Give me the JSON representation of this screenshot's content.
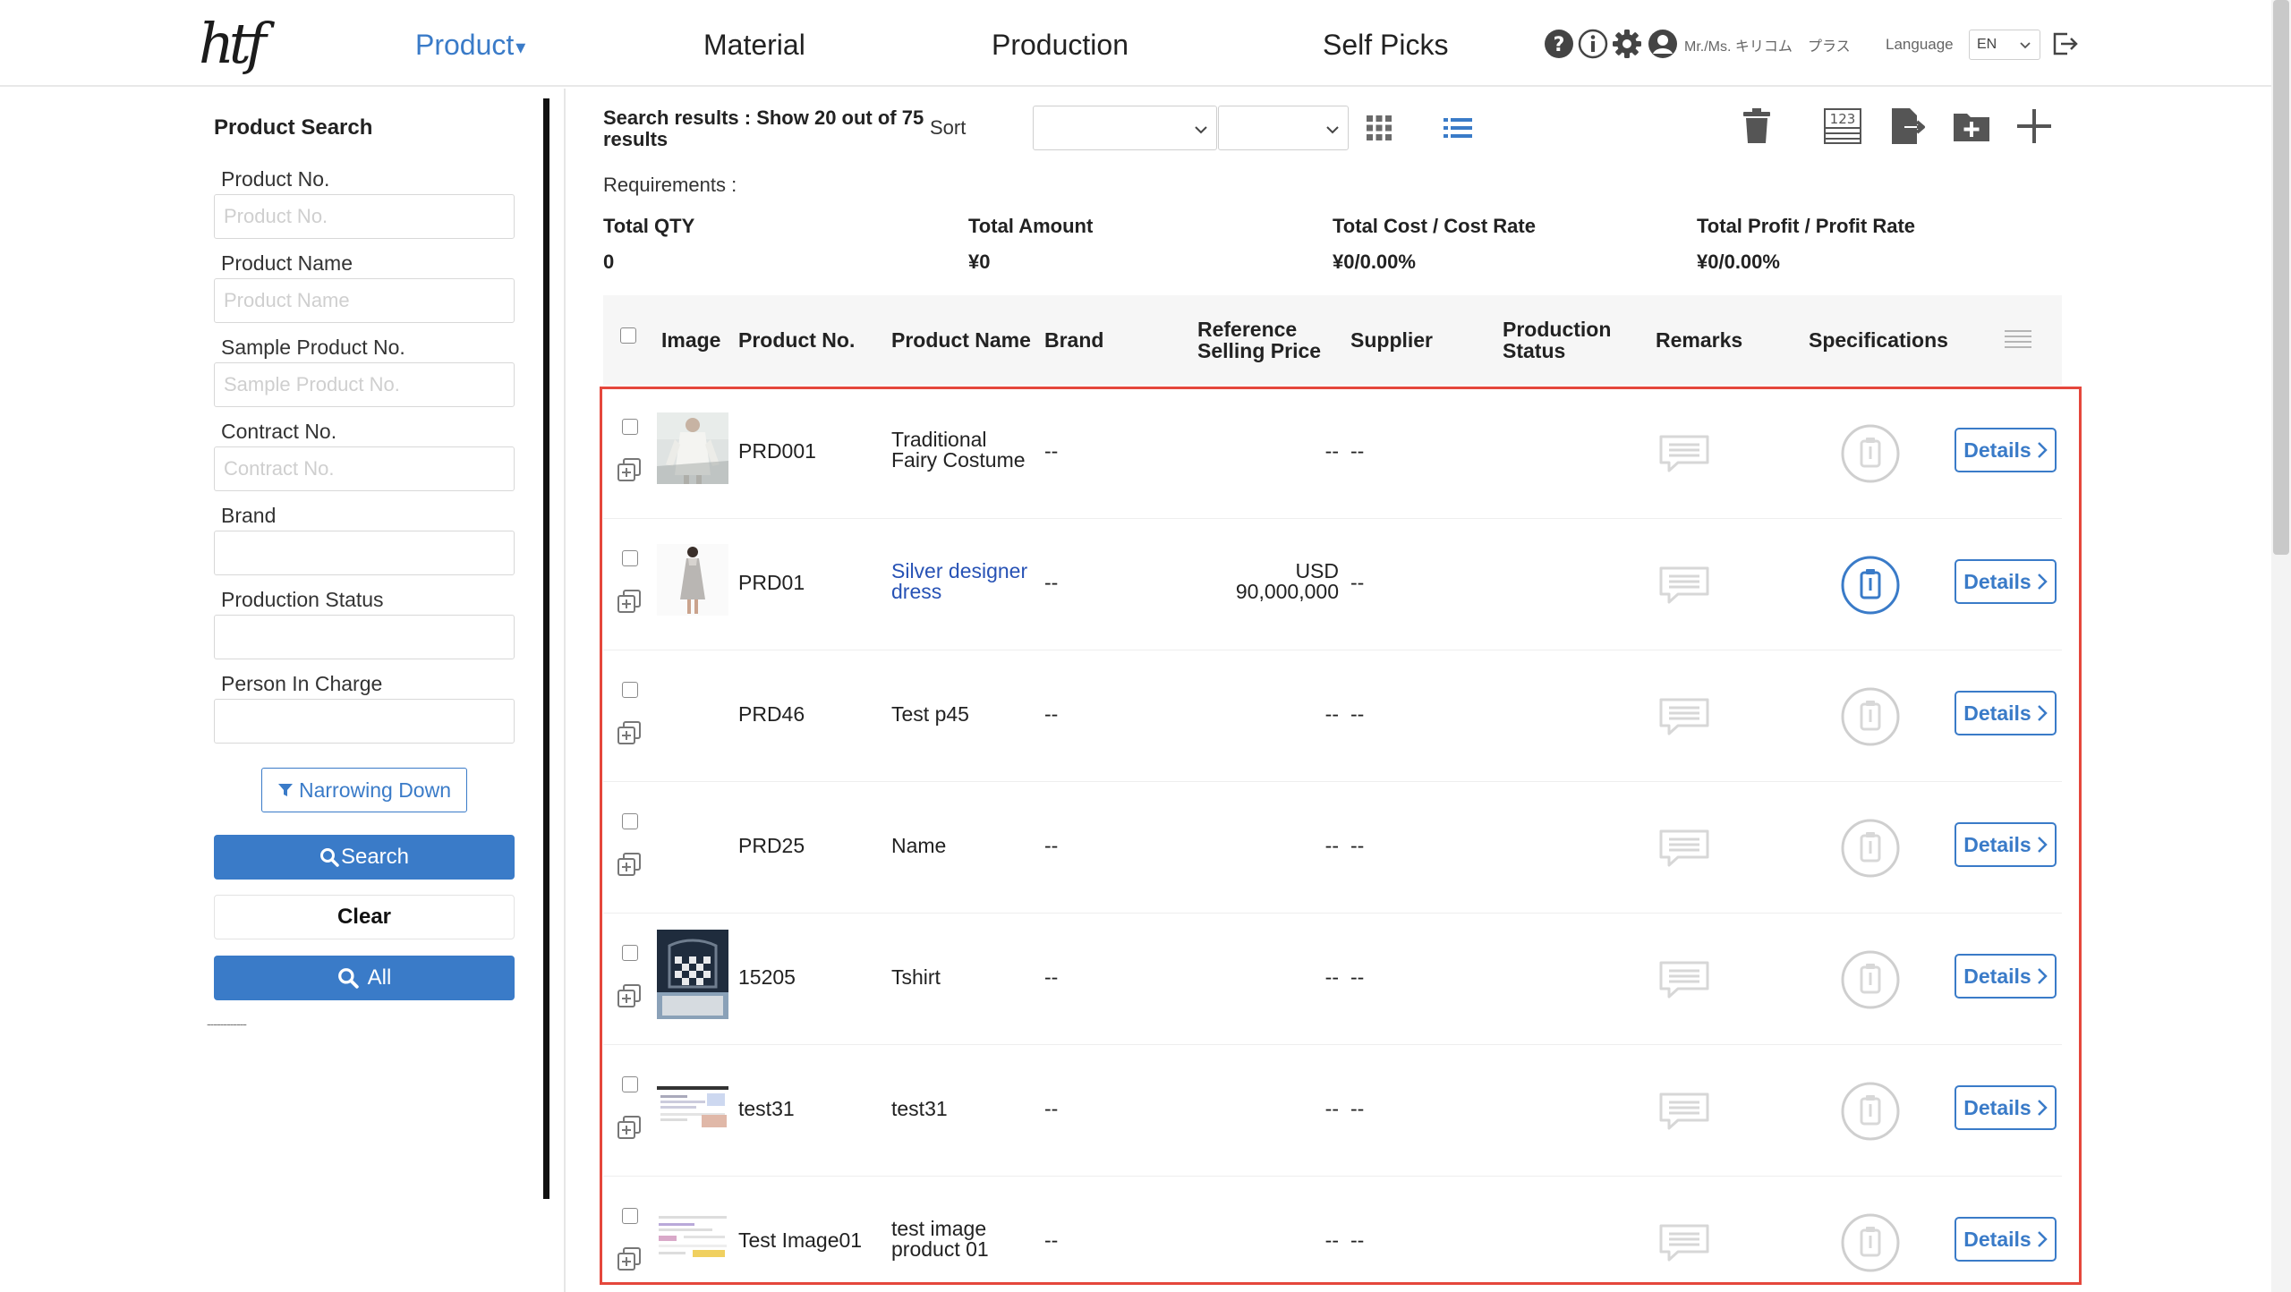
{
  "header": {
    "logo": "htf",
    "nav": [
      {
        "label": "Product",
        "active": true
      },
      {
        "label": "Material",
        "active": false
      },
      {
        "label": "Production",
        "active": false
      },
      {
        "label": "Self Picks",
        "active": false
      }
    ],
    "icons": [
      "help-icon",
      "info-icon",
      "gear-icon",
      "user-icon"
    ],
    "user_name": "Mr./Ms. キリコム",
    "user_plan": "プラス",
    "language_label": "Language",
    "language_value": "EN"
  },
  "sidebar": {
    "title": "Product Search",
    "fields": [
      {
        "label": "Product No.",
        "placeholder": "Product No."
      },
      {
        "label": "Product Name",
        "placeholder": "Product Name"
      },
      {
        "label": "Sample Product No.",
        "placeholder": "Sample Product No."
      },
      {
        "label": "Contract No.",
        "placeholder": "Contract No."
      },
      {
        "label": "Brand",
        "placeholder": ""
      },
      {
        "label": "Production Status",
        "placeholder": ""
      },
      {
        "label": "Person In Charge",
        "placeholder": ""
      }
    ],
    "narrow_label": "Narrowing Down",
    "search_label": "Search",
    "clear_label": "Clear",
    "all_label": "All",
    "dashes": "------------"
  },
  "toolbar": {
    "results_bold": "Search results : Show 20 out of 75",
    "results_rest": "results",
    "sort_label": "Sort",
    "sort1_value": "",
    "sort2_value": ""
  },
  "summary": {
    "requirements_label": "Requirements :",
    "items": [
      {
        "label": "Total QTY",
        "value": "0"
      },
      {
        "label": "Total Amount",
        "value": "¥0"
      },
      {
        "label": "Total Cost / Cost Rate",
        "value": "¥0/0.00%"
      },
      {
        "label": "Total Profit / Profit Rate",
        "value": "¥0/0.00%"
      }
    ]
  },
  "table": {
    "headers": {
      "image": "Image",
      "product_no": "Product No.",
      "product_name": "Product Name",
      "brand": "Brand",
      "price_line1": "Reference",
      "price_line2": "Selling Price",
      "supplier": "Supplier",
      "status_line1": "Production",
      "status_line2": "Status",
      "remarks": "Remarks",
      "specifications": "Specifications"
    },
    "details_label": "Details",
    "rows": [
      {
        "product_no": "PRD001",
        "name_line1": "Traditional",
        "name_line2": "Fairy Costume",
        "brand": "--",
        "price_line1": "",
        "price_line2": "--",
        "supplier": "--",
        "image": "white-outfit",
        "spec_active": false,
        "name_link": false
      },
      {
        "product_no": "PRD01",
        "name_line1": "Silver designer",
        "name_line2": "dress",
        "brand": "--",
        "price_line1": "USD",
        "price_line2": "90,000,000",
        "supplier": "--",
        "image": "silver-dress",
        "spec_active": true,
        "name_link": true
      },
      {
        "product_no": "PRD46",
        "name_line1": "Test p45",
        "name_line2": "",
        "brand": "--",
        "price_line1": "",
        "price_line2": "--",
        "supplier": "--",
        "image": "none",
        "spec_active": false,
        "name_link": false
      },
      {
        "product_no": "PRD25",
        "name_line1": "Name",
        "name_line2": "",
        "brand": "--",
        "price_line1": "",
        "price_line2": "--",
        "supplier": "--",
        "image": "none",
        "spec_active": false,
        "name_link": false
      },
      {
        "product_no": "15205",
        "name_line1": "Tshirt",
        "name_line2": "",
        "brand": "--",
        "price_line1": "",
        "price_line2": "--",
        "supplier": "--",
        "image": "checkered-shirt",
        "spec_active": false,
        "name_link": false
      },
      {
        "product_no": "test31",
        "name_line1": "test31",
        "name_line2": "",
        "brand": "--",
        "price_line1": "",
        "price_line2": "--",
        "supplier": "--",
        "image": "screenshot",
        "spec_active": false,
        "name_link": false
      },
      {
        "product_no": "Test Image01",
        "name_line1": "test image",
        "name_line2": "product 01",
        "brand": "--",
        "price_line1": "",
        "price_line2": "--",
        "supplier": "--",
        "image": "document",
        "spec_active": false,
        "name_link": false
      }
    ]
  },
  "colors": {
    "accent": "#3a7bc8",
    "link": "#2752b5",
    "highlight": "#e5473c"
  }
}
